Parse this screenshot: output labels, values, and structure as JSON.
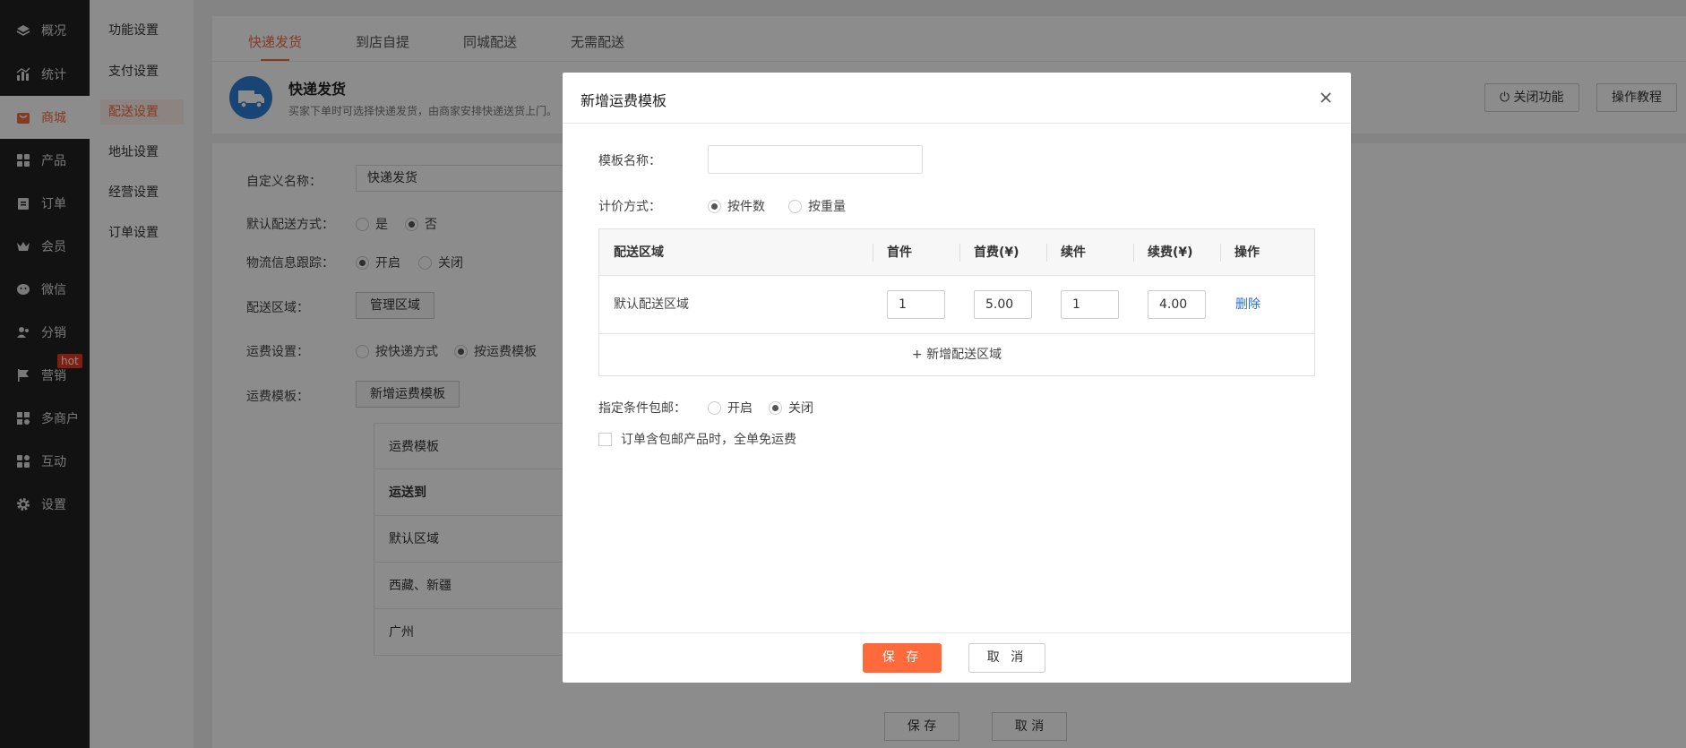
{
  "nav": {
    "items": [
      {
        "label": "概况",
        "icon": "layers-icon"
      },
      {
        "label": "统计",
        "icon": "chart-icon"
      },
      {
        "label": "商城",
        "icon": "shop-icon"
      },
      {
        "label": "产品",
        "icon": "grid-icon"
      },
      {
        "label": "订单",
        "icon": "clipboard-icon"
      },
      {
        "label": "会员",
        "icon": "crown-icon"
      },
      {
        "label": "微信",
        "icon": "wechat-icon"
      },
      {
        "label": "分销",
        "icon": "users-icon"
      },
      {
        "label": "营销",
        "icon": "flag-icon"
      },
      {
        "label": "多商户",
        "icon": "store-icon"
      },
      {
        "label": "互动",
        "icon": "apps-icon"
      },
      {
        "label": "设置",
        "icon": "gear-icon"
      }
    ],
    "active_index": 2,
    "hot_badge": "hot"
  },
  "submenu": {
    "items": [
      "功能设置",
      "支付设置",
      "配送设置",
      "地址设置",
      "经营设置",
      "订单设置"
    ],
    "active_index": 2
  },
  "tabs": [
    "快递发货",
    "到店自提",
    "同城配送",
    "无需配送"
  ],
  "header": {
    "title": "快递发货",
    "desc": "买家下单时可选择快递发货，由商家安排快递送货上门。",
    "btn_close_feature": "关闭功能",
    "btn_tutorial": "操作教程"
  },
  "form": {
    "custom_name_label": "自定义名称：",
    "custom_name_value": "快递发货",
    "default_mode_label": "默认配送方式：",
    "yes": "是",
    "no": "否",
    "tracking_label": "物流信息跟踪：",
    "on": "开启",
    "off": "关闭",
    "area_label": "配送区域：",
    "area_btn": "管理区域",
    "fee_label": "运费设置：",
    "fee_opt1": "按快递方式",
    "fee_opt2": "按运费模板",
    "tmpl_label": "运费模板：",
    "tmpl_btn": "新增运费模板",
    "tmpl_rows": [
      "运费模板",
      "运送到",
      "默认区域",
      "西藏、新疆",
      "广州"
    ]
  },
  "bottom": {
    "save": "保 存",
    "cancel": "取 消"
  },
  "modal": {
    "title": "新增运费模板",
    "name_label": "模板名称：",
    "name_value": "",
    "pricing_label": "计价方式：",
    "pricing_opt1": "按件数",
    "pricing_opt2": "按重量",
    "table": {
      "headers": [
        "配送区域",
        "首件",
        "首费(¥)",
        "续件",
        "续费(¥)",
        "操作"
      ],
      "row": {
        "area": "默认配送区域",
        "first": "1",
        "first_fee": "5.00",
        "next": "1",
        "next_fee": "4.00",
        "action": "删除"
      },
      "add_label": "新增配送区域"
    },
    "free_label": "指定条件包邮：",
    "free_on": "开启",
    "free_off": "关闭",
    "checkbox_label": "订单含包邮产品时，全单免运费",
    "save": "保 存",
    "cancel": "取 消"
  },
  "colors": {
    "accent": "#f26b43",
    "save_btn": "#ff6a3d",
    "nav_bg": "#222222",
    "link": "#2a6fce"
  }
}
